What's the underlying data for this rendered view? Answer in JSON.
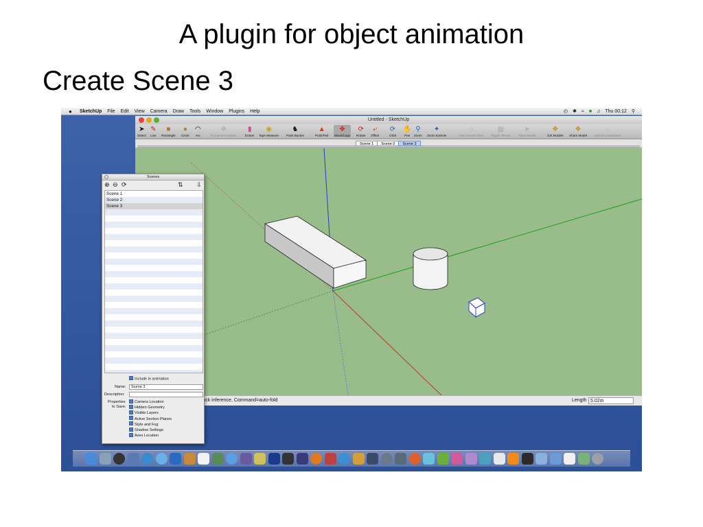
{
  "slide": {
    "title": "A plugin for object animation",
    "heading": "Create Scene 3"
  },
  "menubar": {
    "apple": "",
    "items": [
      "SketchUp",
      "File",
      "Edit",
      "View",
      "Camera",
      "Draw",
      "Tools",
      "Window",
      "Plugins",
      "Help"
    ],
    "clock": "Thu 00:12"
  },
  "window": {
    "title": "Untitled - SketchUp",
    "tools": [
      "Select",
      "Line",
      "Rectangle",
      "Circle",
      "Arc",
      "Component Maker",
      "Eraser",
      "Tape Measure",
      "Paint Bucket",
      "Push/Pull",
      "Move/Copy",
      "Rotate",
      "Offset",
      "Orbit",
      "Pan",
      "Zoom",
      "Zoom Extents",
      "Get Current View",
      "Toggle Terrain",
      "Place Model",
      "Get Models",
      "Share Model",
      "Upload Component"
    ],
    "scene_tabs": [
      "Scene 1",
      "Scene 2",
      "Scene 3"
    ],
    "active_tab": "Scene 3",
    "status_message": "to move.  Option=copy, Shift=lock inference, Command=auto-fold",
    "length_label": "Length",
    "length_value": "5.02m"
  },
  "scenes_panel": {
    "title": "Scenes",
    "scenes": [
      "Scene 1",
      "Scene 2",
      "Scene 3"
    ],
    "selected": "Scene 3",
    "include_label": "Include in animation",
    "name_label": "Name:",
    "name_value": "Scene 3",
    "description_label": "Description:",
    "description_value": "",
    "properties_label_1": "Properties",
    "properties_label_2": "to Save:",
    "properties": [
      "Camera Location",
      "Hidden Geometry",
      "Visible Layers",
      "Active Section Planes",
      "Style and Fog",
      "Shadow Settings",
      "Axes Location"
    ]
  },
  "colors": {
    "viewport": "#98bc8a",
    "desktop": "#3256a0",
    "axis_blue": "#2b36c8",
    "axis_green": "#1aa01a",
    "axis_red": "#b53a2a"
  }
}
